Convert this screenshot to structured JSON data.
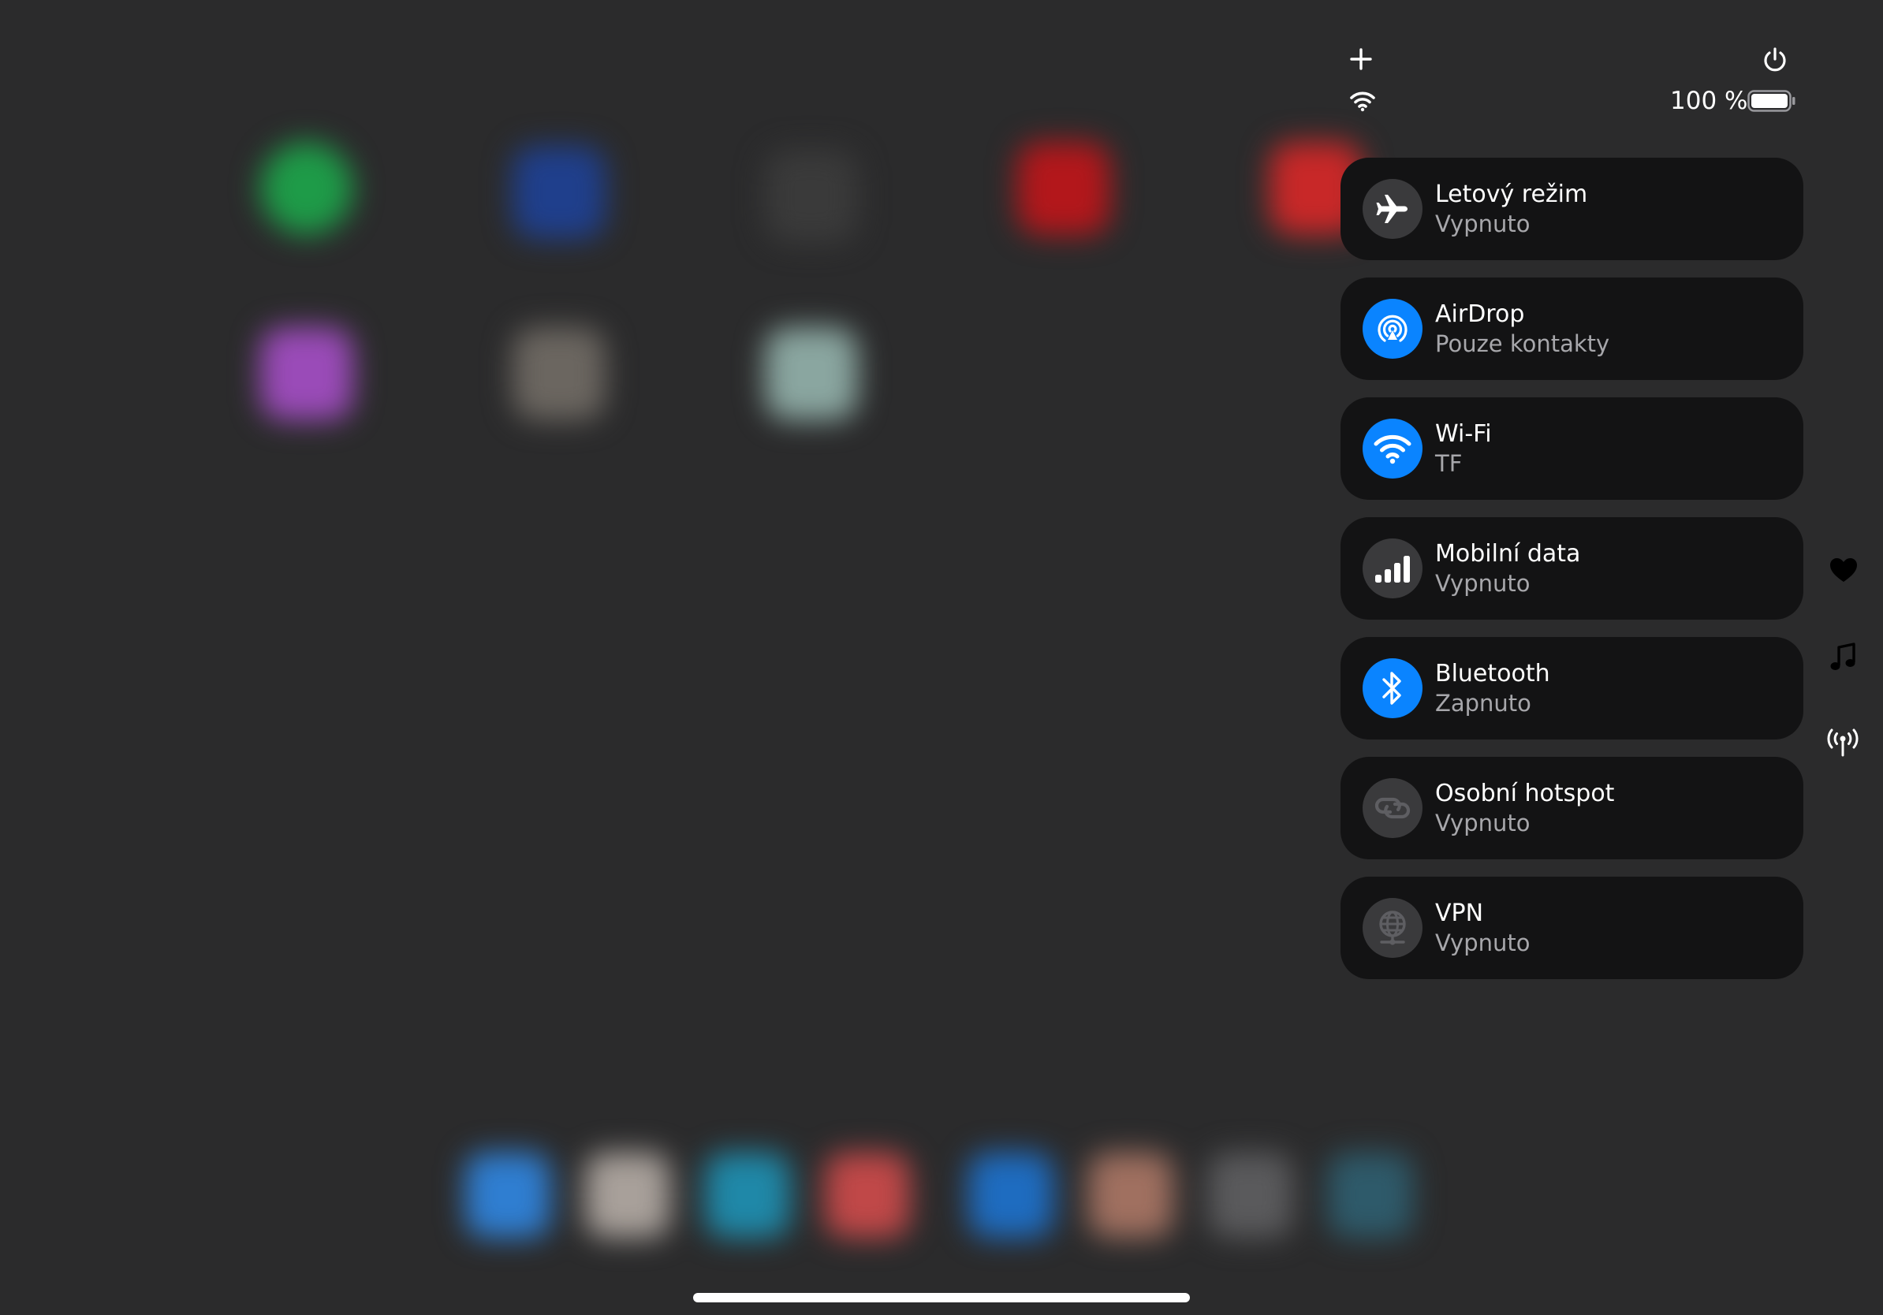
{
  "status": {
    "battery_text": "100 %"
  },
  "colors": {
    "accent": "#0a84ff",
    "tile_bg": "#131314",
    "icon_off_bg": "#3a3a3c"
  },
  "connectivity": {
    "airplane": {
      "title": "Letový režim",
      "status": "Vypnuto",
      "icon": "airplane-icon",
      "active": false
    },
    "airdrop": {
      "title": "AirDrop",
      "status": "Pouze kontakty",
      "icon": "airdrop-icon",
      "active": true
    },
    "wifi": {
      "title": "Wi-Fi",
      "status": "TF",
      "icon": "wifi-icon",
      "active": true
    },
    "cellular": {
      "title": "Mobilní data",
      "status": "Vypnuto",
      "icon": "cellular-icon",
      "active": false
    },
    "bluetooth": {
      "title": "Bluetooth",
      "status": "Zapnuto",
      "icon": "bluetooth-icon",
      "active": true
    },
    "hotspot": {
      "title": "Osobní hotspot",
      "status": "Vypnuto",
      "icon": "hotspot-icon",
      "active": false
    },
    "vpn": {
      "title": "VPN",
      "status": "Vypnuto",
      "icon": "vpn-icon",
      "active": false
    }
  },
  "side_icons": [
    "heart-icon",
    "music-icon",
    "antenna-icon"
  ]
}
